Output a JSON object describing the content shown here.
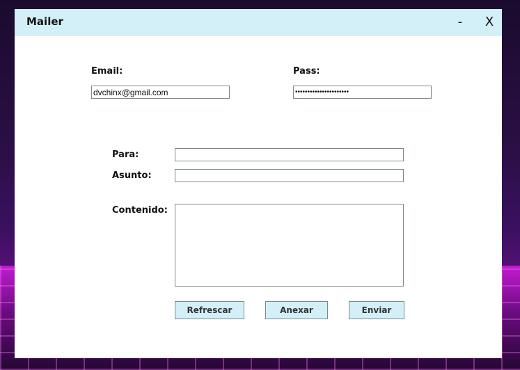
{
  "window": {
    "title": "Mailer",
    "minimize_label": "-",
    "close_label": "X"
  },
  "login": {
    "email_label": "Email:",
    "email_value": "dvchinx@gmail.com",
    "pass_label": "Pass:",
    "pass_value": "••••••••••••••••••••••"
  },
  "compose": {
    "to_label": "Para:",
    "to_value": "",
    "subject_label": "Asunto:",
    "subject_value": "",
    "content_label": "Contenido:",
    "content_value": ""
  },
  "actions": {
    "refresh_label": "Refrescar",
    "attach_label": "Anexar",
    "send_label": "Enviar"
  },
  "colors": {
    "titlebar": "#d3eff7",
    "button_bg": "#d3eff7",
    "field_border": "#7a8a8a"
  }
}
